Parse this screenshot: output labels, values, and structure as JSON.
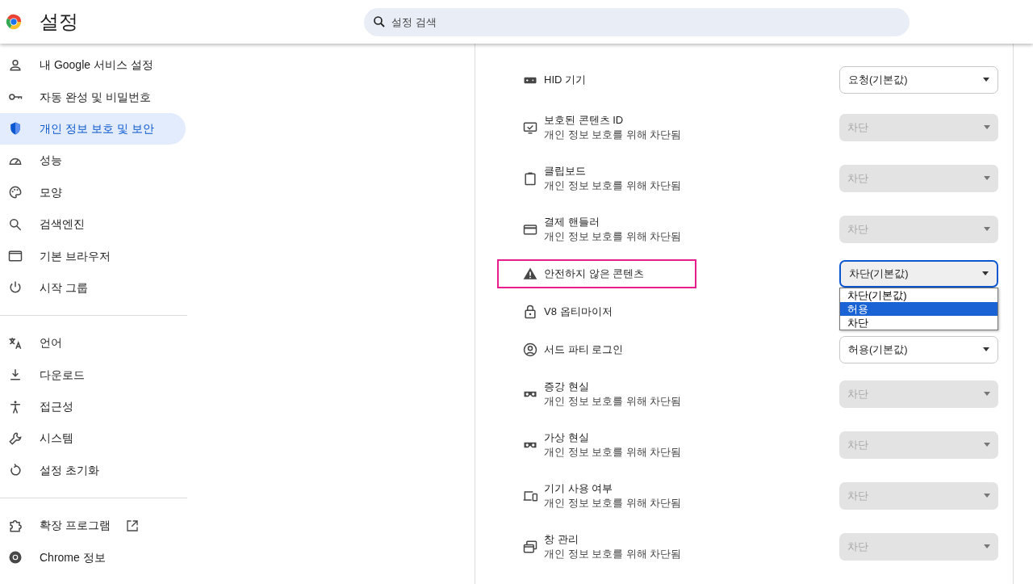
{
  "header": {
    "title": "설정",
    "search": {
      "placeholder": "설정 검색"
    }
  },
  "sidebar": {
    "groups": [
      {
        "items": [
          {
            "label": "내 Google 서비스 설정",
            "selected": false
          },
          {
            "label": "자동 완성 및 비밀번호",
            "selected": false
          },
          {
            "label": "개인 정보 보호 및 보안",
            "selected": true
          },
          {
            "label": "성능",
            "selected": false
          },
          {
            "label": "모양",
            "selected": false
          },
          {
            "label": "검색엔진",
            "selected": false
          },
          {
            "label": "기본 브라우저",
            "selected": false
          },
          {
            "label": "시작 그룹",
            "selected": false
          }
        ]
      },
      {
        "items": [
          {
            "label": "언어",
            "selected": false
          },
          {
            "label": "다운로드",
            "selected": false
          },
          {
            "label": "접근성",
            "selected": false
          },
          {
            "label": "시스템",
            "selected": false
          },
          {
            "label": "설정 초기화",
            "selected": false
          }
        ]
      },
      {
        "items": [
          {
            "label": "확장 프로그램",
            "selected": false,
            "external": true
          },
          {
            "label": "Chrome 정보",
            "selected": false
          }
        ]
      }
    ]
  },
  "permissions": [
    {
      "title": "HID 기기",
      "value": "요청(기본값)",
      "disabled": false
    },
    {
      "title": "보호된 콘텐츠 ID",
      "subtitle": "개인 정보 보호를 위해 차단됨",
      "value": "차단",
      "disabled": true
    },
    {
      "title": "클립보드",
      "subtitle": "개인 정보 보호를 위해 차단됨",
      "value": "차단",
      "disabled": true
    },
    {
      "title": "결제 핸들러",
      "subtitle": "개인 정보 보호를 위해 차단됨",
      "value": "차단",
      "disabled": true
    },
    {
      "title": "안전하지 않은 콘텐츠",
      "value": "차단(기본값)",
      "disabled": false,
      "focused": true,
      "highlighted": true,
      "options": [
        {
          "label": "차단(기본값)",
          "highlighted": false
        },
        {
          "label": "허용",
          "highlighted": true
        },
        {
          "label": "차단",
          "highlighted": false
        }
      ]
    },
    {
      "title": "V8 옵티마이저"
    },
    {
      "title": "서드 파티 로그인",
      "value": "허용(기본값)",
      "disabled": false
    },
    {
      "title": "증강 현실",
      "subtitle": "개인 정보 보호를 위해 차단됨",
      "value": "차단",
      "disabled": true
    },
    {
      "title": "가상 현실",
      "subtitle": "개인 정보 보호를 위해 차단됨",
      "value": "차단",
      "disabled": true
    },
    {
      "title": "기기 사용 여부",
      "subtitle": "개인 정보 보호를 위해 차단됨",
      "value": "차단",
      "disabled": true
    },
    {
      "title": "창 관리",
      "subtitle": "개인 정보 보호를 위해 차단됨",
      "value": "차단",
      "disabled": true
    }
  ]
}
